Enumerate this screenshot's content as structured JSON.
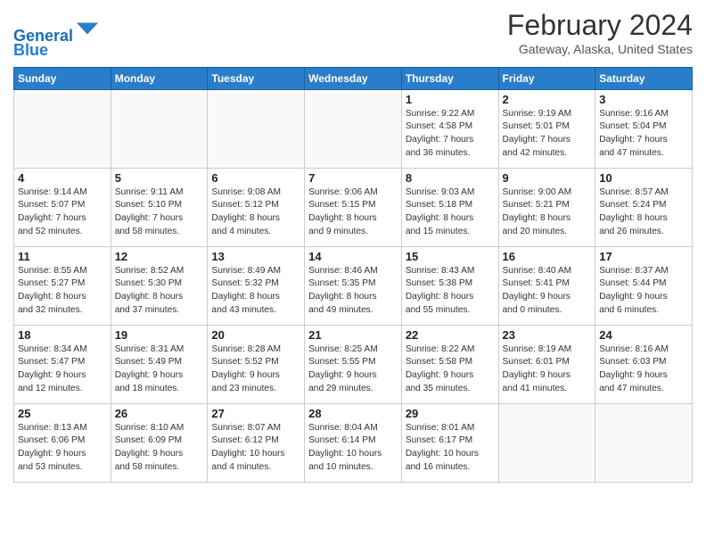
{
  "header": {
    "logo_line1": "General",
    "logo_line2": "Blue",
    "title": "February 2024",
    "subtitle": "Gateway, Alaska, United States"
  },
  "days_of_week": [
    "Sunday",
    "Monday",
    "Tuesday",
    "Wednesday",
    "Thursday",
    "Friday",
    "Saturday"
  ],
  "weeks": [
    [
      {
        "day": "",
        "info": ""
      },
      {
        "day": "",
        "info": ""
      },
      {
        "day": "",
        "info": ""
      },
      {
        "day": "",
        "info": ""
      },
      {
        "day": "1",
        "info": "Sunrise: 9:22 AM\nSunset: 4:58 PM\nDaylight: 7 hours\nand 36 minutes."
      },
      {
        "day": "2",
        "info": "Sunrise: 9:19 AM\nSunset: 5:01 PM\nDaylight: 7 hours\nand 42 minutes."
      },
      {
        "day": "3",
        "info": "Sunrise: 9:16 AM\nSunset: 5:04 PM\nDaylight: 7 hours\nand 47 minutes."
      }
    ],
    [
      {
        "day": "4",
        "info": "Sunrise: 9:14 AM\nSunset: 5:07 PM\nDaylight: 7 hours\nand 52 minutes."
      },
      {
        "day": "5",
        "info": "Sunrise: 9:11 AM\nSunset: 5:10 PM\nDaylight: 7 hours\nand 58 minutes."
      },
      {
        "day": "6",
        "info": "Sunrise: 9:08 AM\nSunset: 5:12 PM\nDaylight: 8 hours\nand 4 minutes."
      },
      {
        "day": "7",
        "info": "Sunrise: 9:06 AM\nSunset: 5:15 PM\nDaylight: 8 hours\nand 9 minutes."
      },
      {
        "day": "8",
        "info": "Sunrise: 9:03 AM\nSunset: 5:18 PM\nDaylight: 8 hours\nand 15 minutes."
      },
      {
        "day": "9",
        "info": "Sunrise: 9:00 AM\nSunset: 5:21 PM\nDaylight: 8 hours\nand 20 minutes."
      },
      {
        "day": "10",
        "info": "Sunrise: 8:57 AM\nSunset: 5:24 PM\nDaylight: 8 hours\nand 26 minutes."
      }
    ],
    [
      {
        "day": "11",
        "info": "Sunrise: 8:55 AM\nSunset: 5:27 PM\nDaylight: 8 hours\nand 32 minutes."
      },
      {
        "day": "12",
        "info": "Sunrise: 8:52 AM\nSunset: 5:30 PM\nDaylight: 8 hours\nand 37 minutes."
      },
      {
        "day": "13",
        "info": "Sunrise: 8:49 AM\nSunset: 5:32 PM\nDaylight: 8 hours\nand 43 minutes."
      },
      {
        "day": "14",
        "info": "Sunrise: 8:46 AM\nSunset: 5:35 PM\nDaylight: 8 hours\nand 49 minutes."
      },
      {
        "day": "15",
        "info": "Sunrise: 8:43 AM\nSunset: 5:38 PM\nDaylight: 8 hours\nand 55 minutes."
      },
      {
        "day": "16",
        "info": "Sunrise: 8:40 AM\nSunset: 5:41 PM\nDaylight: 9 hours\nand 0 minutes."
      },
      {
        "day": "17",
        "info": "Sunrise: 8:37 AM\nSunset: 5:44 PM\nDaylight: 9 hours\nand 6 minutes."
      }
    ],
    [
      {
        "day": "18",
        "info": "Sunrise: 8:34 AM\nSunset: 5:47 PM\nDaylight: 9 hours\nand 12 minutes."
      },
      {
        "day": "19",
        "info": "Sunrise: 8:31 AM\nSunset: 5:49 PM\nDaylight: 9 hours\nand 18 minutes."
      },
      {
        "day": "20",
        "info": "Sunrise: 8:28 AM\nSunset: 5:52 PM\nDaylight: 9 hours\nand 23 minutes."
      },
      {
        "day": "21",
        "info": "Sunrise: 8:25 AM\nSunset: 5:55 PM\nDaylight: 9 hours\nand 29 minutes."
      },
      {
        "day": "22",
        "info": "Sunrise: 8:22 AM\nSunset: 5:58 PM\nDaylight: 9 hours\nand 35 minutes."
      },
      {
        "day": "23",
        "info": "Sunrise: 8:19 AM\nSunset: 6:01 PM\nDaylight: 9 hours\nand 41 minutes."
      },
      {
        "day": "24",
        "info": "Sunrise: 8:16 AM\nSunset: 6:03 PM\nDaylight: 9 hours\nand 47 minutes."
      }
    ],
    [
      {
        "day": "25",
        "info": "Sunrise: 8:13 AM\nSunset: 6:06 PM\nDaylight: 9 hours\nand 53 minutes."
      },
      {
        "day": "26",
        "info": "Sunrise: 8:10 AM\nSunset: 6:09 PM\nDaylight: 9 hours\nand 58 minutes."
      },
      {
        "day": "27",
        "info": "Sunrise: 8:07 AM\nSunset: 6:12 PM\nDaylight: 10 hours\nand 4 minutes."
      },
      {
        "day": "28",
        "info": "Sunrise: 8:04 AM\nSunset: 6:14 PM\nDaylight: 10 hours\nand 10 minutes."
      },
      {
        "day": "29",
        "info": "Sunrise: 8:01 AM\nSunset: 6:17 PM\nDaylight: 10 hours\nand 16 minutes."
      },
      {
        "day": "",
        "info": ""
      },
      {
        "day": "",
        "info": ""
      }
    ]
  ]
}
